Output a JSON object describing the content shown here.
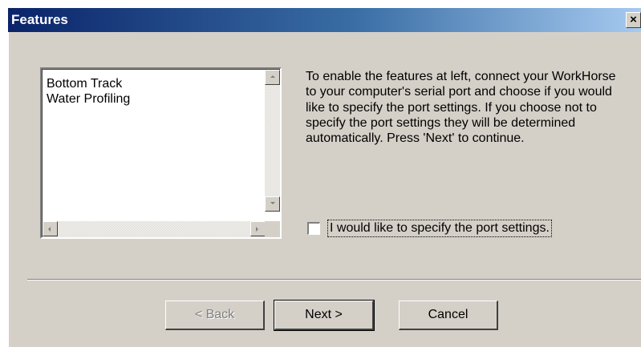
{
  "dialog": {
    "title": "Features",
    "close_symbol": "×"
  },
  "listbox": {
    "items": [
      "Bottom Track",
      "Water Profiling"
    ]
  },
  "description": "To enable the features at left, connect your WorkHorse to your computer's serial port and choose if you would like to specify the port settings. If you choose not to specify the port settings they will be determined automatically. Press 'Next' to continue.",
  "checkbox": {
    "label": "I would like to specify the port settings.",
    "checked": false
  },
  "buttons": {
    "back": "< Back",
    "next": "Next >",
    "cancel": "Cancel"
  },
  "icons": {
    "scroll_up": "arrow-up-icon",
    "scroll_down": "arrow-down-icon",
    "scroll_left": "arrow-left-icon",
    "scroll_right": "arrow-right-icon"
  },
  "colors": {
    "title_gradient_start": "#0a246a",
    "title_gradient_end": "#a6caf0",
    "dialog_face": "#d4d0c8"
  }
}
